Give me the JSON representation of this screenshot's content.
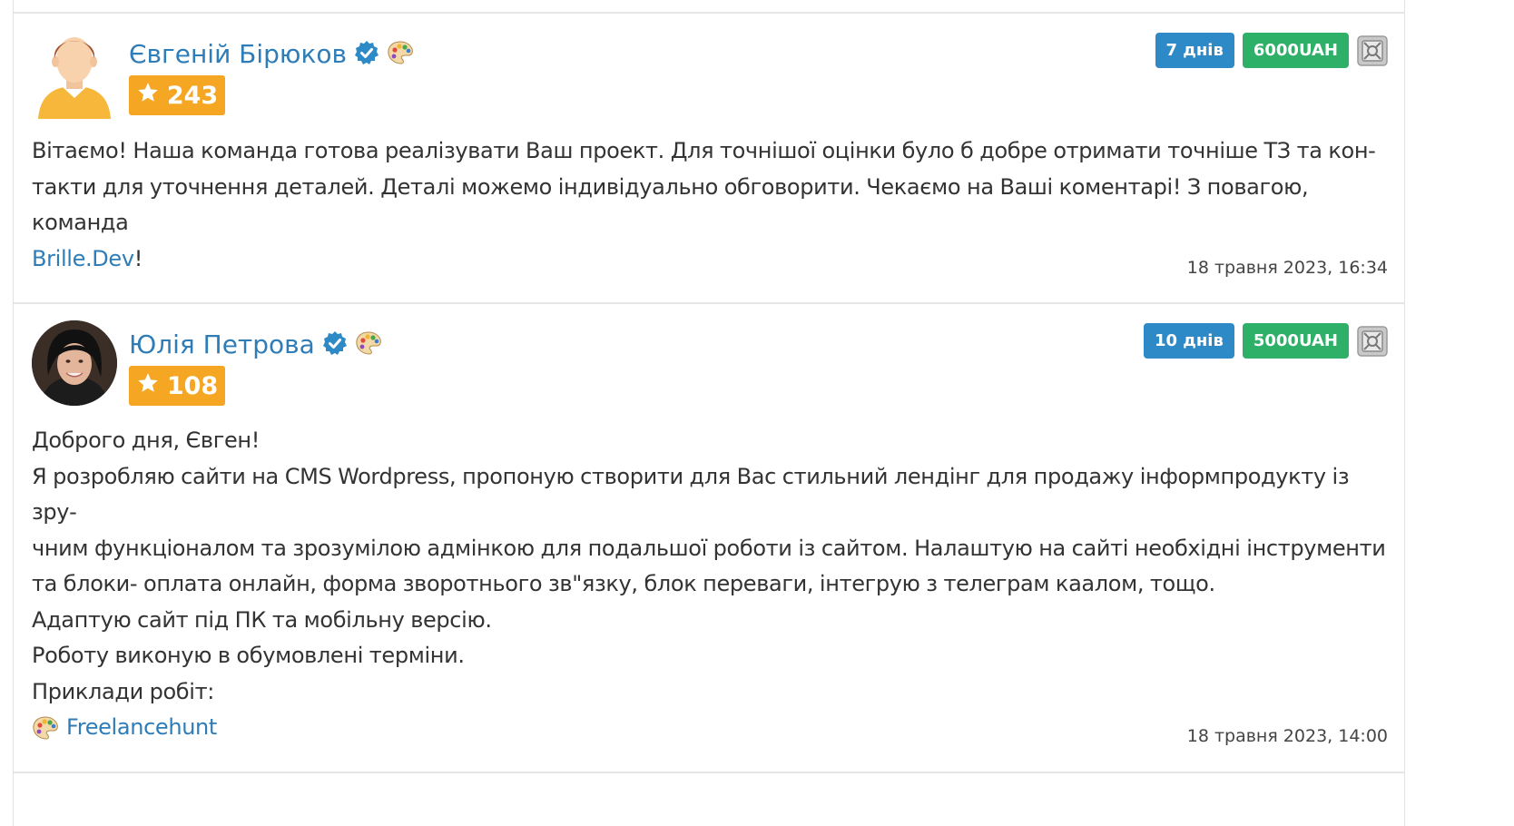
{
  "bids": [
    {
      "user_name": "Євгеній Бірюков",
      "rating": "243",
      "days_badge": "7 днів",
      "price_badge": "6000UAH",
      "message_lines": [
        "Вітаємо! Наша команда готова реалізувати Ваш проект. Для точнішої оцінки було б добре отримати точніше ТЗ та кон-",
        "такти для уточнення деталей. Деталі можемо індивідуально обговорити. Чекаємо на Ваші коментарі! З повагою, команда"
      ],
      "link_text": "Brille.Dev",
      "link_suffix": "!",
      "date": "18 травня 2023, 16:34"
    },
    {
      "user_name": "Юлія Петрова",
      "rating": "108",
      "days_badge": "10 днів",
      "price_badge": "5000UAH",
      "message_lines": [
        "Доброго дня, Євген!",
        "Я розробляю сайти на CMS Wordpress, пропоную створити для Вас стильний лендінг для продажу інформпродукту із зру-",
        "чним функціоналом та зрозумілою адмінкою для подальшої роботи із сайтом. Налаштую на сайті необхідні інструменти",
        "та блоки- оплата онлайн, форма зворотнього зв\"язку, блок переваги, інтегрую з телеграм каалом, тощо.",
        "Адаптую сайт під ПК та мобільну версію.",
        "Роботу виконую в обумовлені терміни.",
        "Приклади робіт:"
      ],
      "link_text": "Freelancehunt",
      "date": "18 травня 2023, 14:00"
    }
  ],
  "icons": {
    "verified": "verified-badge-icon",
    "designer": "palette-icon",
    "star": "star-icon",
    "safe": "safe-deal-icon"
  },
  "colors": {
    "link": "#2e7db8",
    "rating": "#f5a623",
    "days": "#2d8ac6",
    "price": "#2fb068"
  }
}
